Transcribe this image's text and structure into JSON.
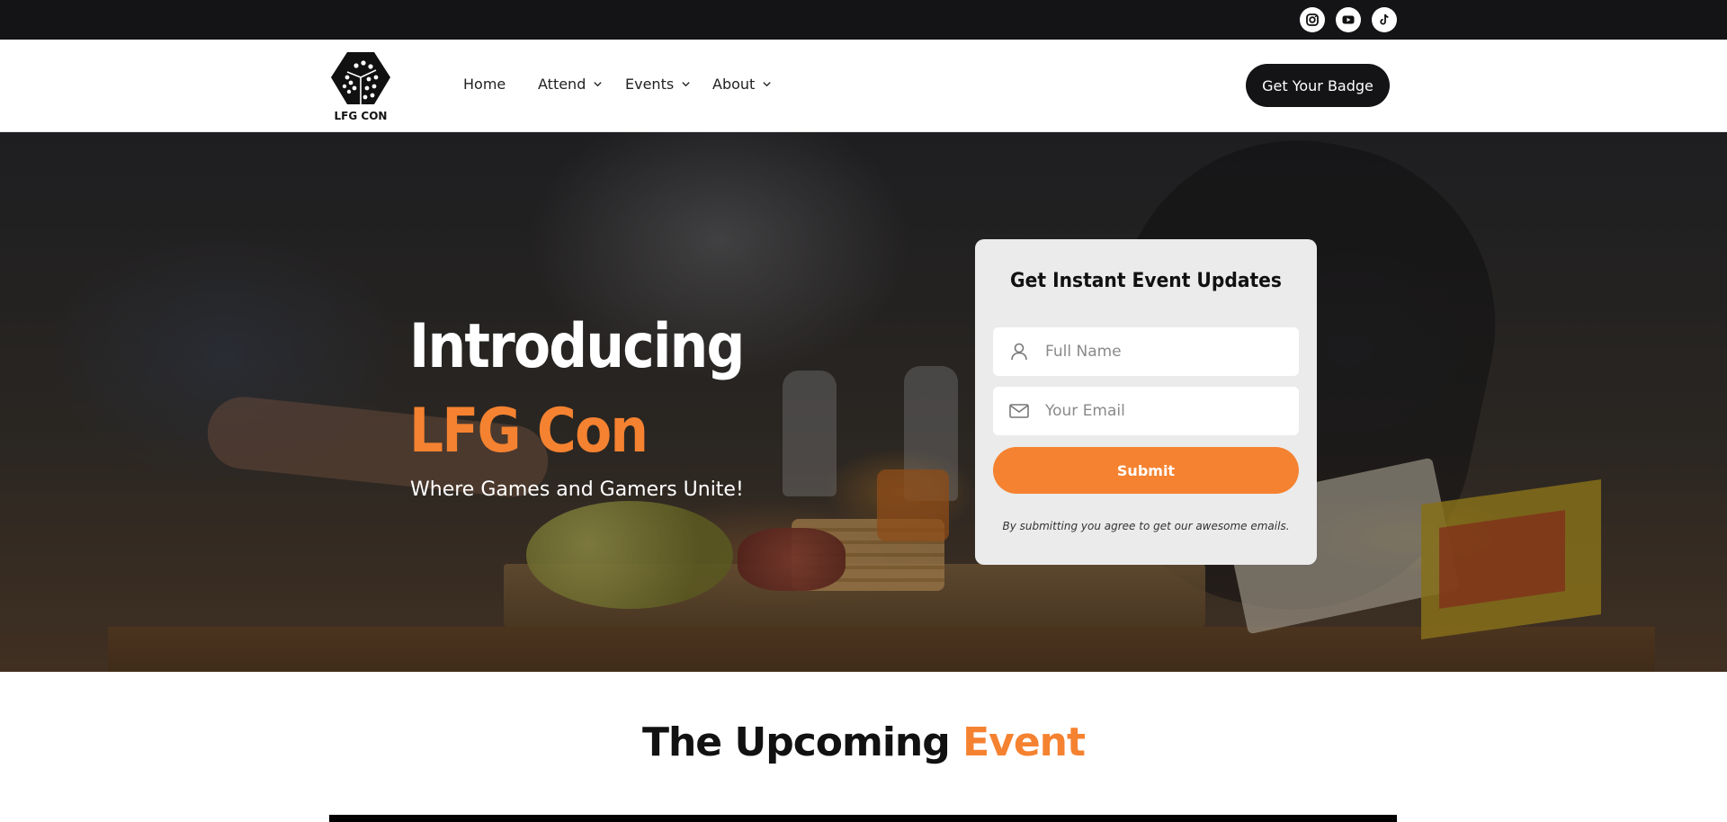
{
  "topbar": {
    "social": [
      {
        "icon": "instagram-icon"
      },
      {
        "icon": "youtube-icon"
      },
      {
        "icon": "tiktok-icon"
      }
    ]
  },
  "nav": {
    "logo_text": "LFG CON",
    "items": [
      {
        "label": "Home",
        "has_dropdown": false
      },
      {
        "label": "Attend",
        "has_dropdown": true
      },
      {
        "label": "Events",
        "has_dropdown": true
      },
      {
        "label": "About",
        "has_dropdown": true
      }
    ],
    "cta_label": "Get Your Badge"
  },
  "hero": {
    "title_line1": "Introducing",
    "title_line2": "LFG Con",
    "subtitle": "Where Games and Gamers Unite!"
  },
  "signup": {
    "title": "Get Instant Event Updates",
    "name_placeholder": "Full Name",
    "email_placeholder": "Your Email",
    "submit_label": "Submit",
    "disclaimer": "By submitting you agree to get our awesome emails."
  },
  "upcoming": {
    "title_part1": "The Upcoming",
    "title_part2": "Event"
  },
  "colors": {
    "accent": "#f58230",
    "dark": "#141417"
  }
}
